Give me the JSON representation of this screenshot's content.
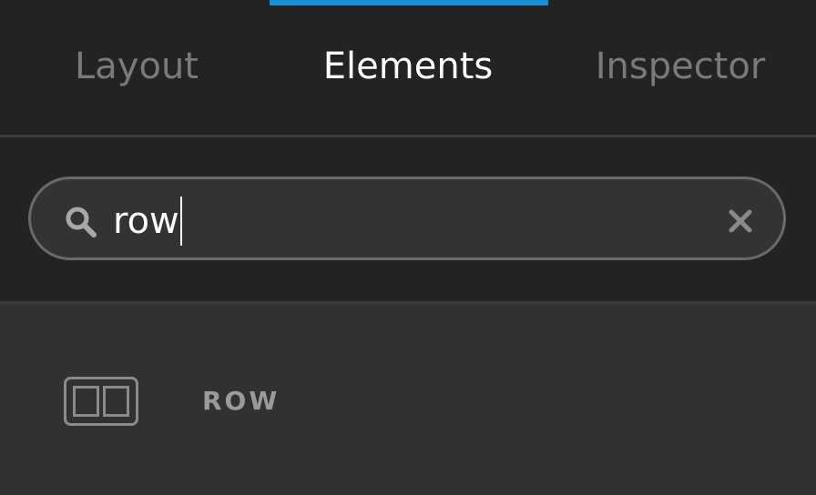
{
  "tabs": {
    "layout": "Layout",
    "elements": "Elements",
    "inspector": "Inspector",
    "active": "Elements"
  },
  "search": {
    "value": "row",
    "icon": "search-icon",
    "clear_icon": "close-icon"
  },
  "results": [
    {
      "label": "ROW",
      "icon": "row-layout-icon"
    }
  ],
  "colors": {
    "accent": "#1a8fd6",
    "background": "#232323",
    "results_background": "#313131",
    "inactive_tab": "#7a7a7a",
    "active_tab": "#ffffff"
  }
}
